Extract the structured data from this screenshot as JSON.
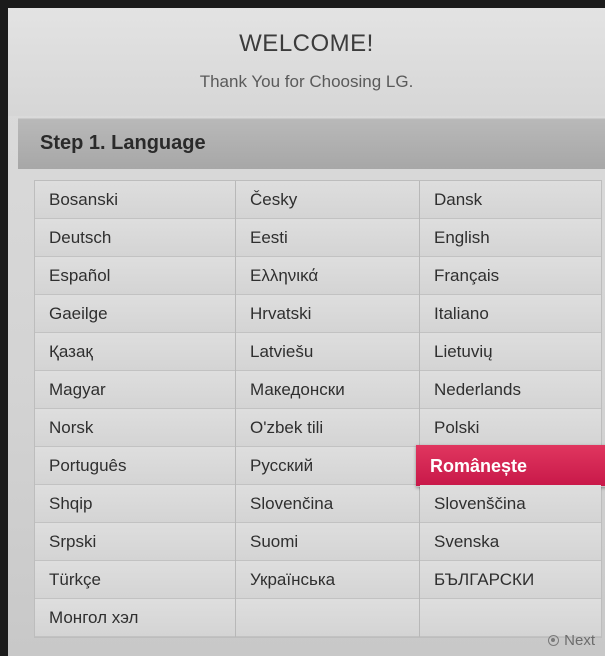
{
  "header": {
    "title": "WELCOME!",
    "subtitle": "Thank You for Choosing LG."
  },
  "step": {
    "title": "Step 1.  Language"
  },
  "languages": {
    "columns": [
      [
        "Bosanski",
        "Deutsch",
        "Español",
        "Gaeilge",
        "Қазақ",
        "Magyar",
        "Norsk",
        "Português",
        "Shqip",
        "Srpski",
        "Türkçe",
        "Монгол хэл"
      ],
      [
        "Česky",
        "Eesti",
        "Ελληνικά",
        "Hrvatski",
        "Latviešu",
        "Македонски",
        "O'zbek tili",
        "Русский",
        "Slovenčina",
        "Suomi",
        "Українська",
        ""
      ],
      [
        "Dansk",
        "English",
        "Français",
        "Italiano",
        "Lietuvių",
        "Nederlands",
        "Polski",
        "Românește",
        "Slovenščina",
        "Svenska",
        "БЪЛГАРСКИ",
        ""
      ]
    ],
    "selected": "Românește",
    "selected_color": "#d42656"
  },
  "footer": {
    "next_label": "Next",
    "next_icon": "circle-button-icon"
  }
}
